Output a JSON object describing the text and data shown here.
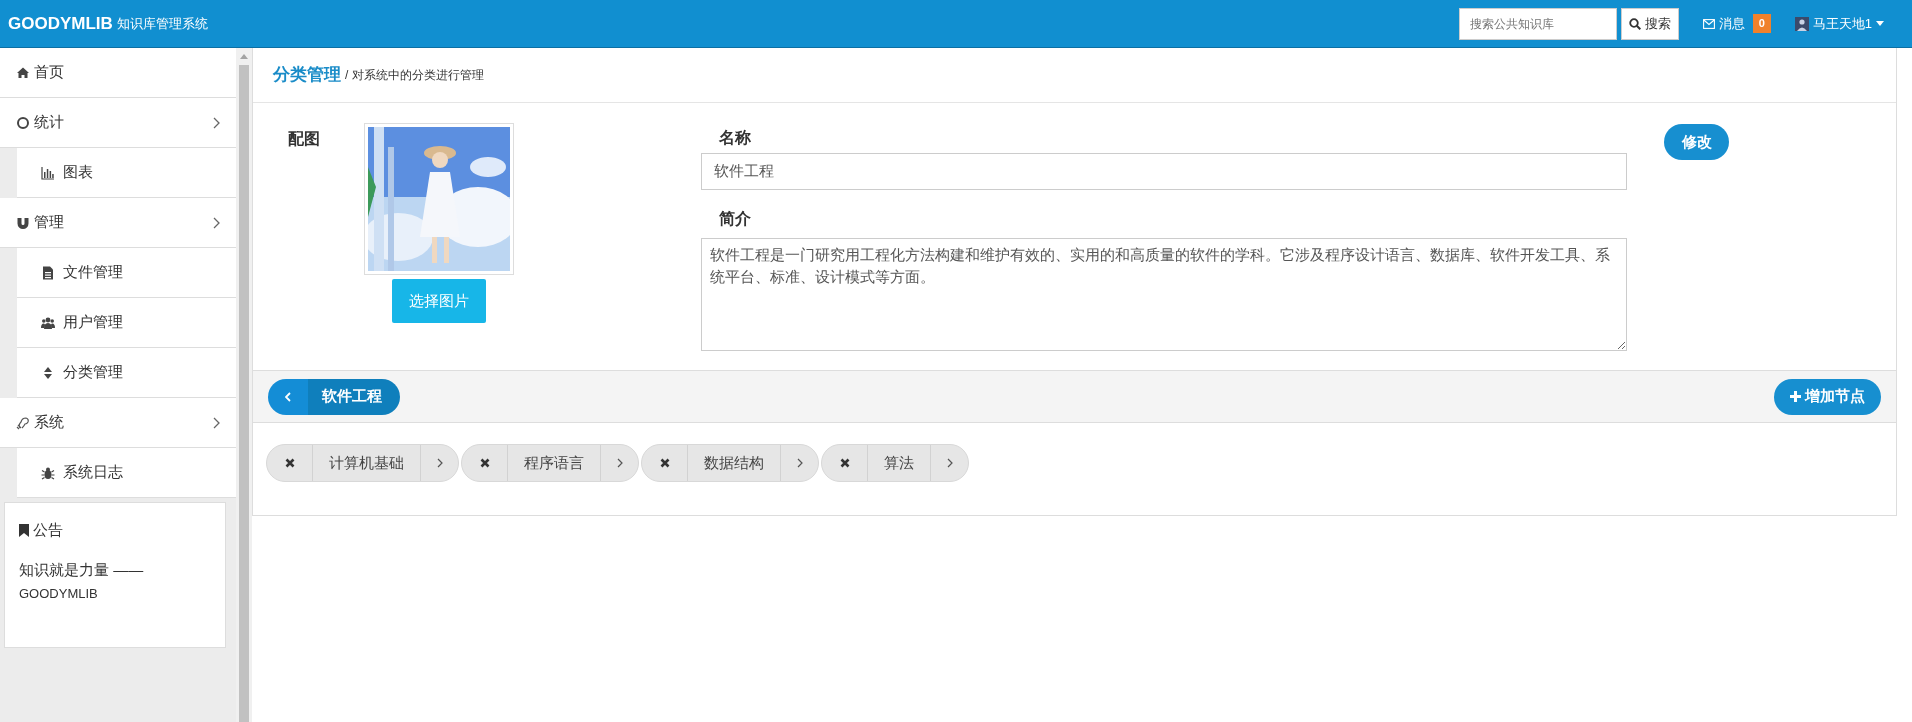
{
  "header": {
    "brand": "GOODYMLIB",
    "subtitle": "知识库管理系统",
    "search": {
      "placeholder": "搜索公共知识库"
    },
    "search_button": "搜索",
    "messages": {
      "label": "消息",
      "count": "0"
    },
    "user": "马王天地1"
  },
  "sidebar": {
    "items": [
      {
        "label": "首页"
      },
      {
        "label": "统计",
        "children": [
          {
            "label": "图表"
          }
        ]
      },
      {
        "label": "管理",
        "children": [
          {
            "label": "文件管理"
          },
          {
            "label": "用户管理"
          },
          {
            "label": "分类管理"
          }
        ]
      },
      {
        "label": "系统",
        "children": [
          {
            "label": "系统日志"
          }
        ]
      }
    ],
    "notice": {
      "title": "公告",
      "lines": [
        "知识就是力量 ——",
        "GOODYMLIB"
      ]
    }
  },
  "page": {
    "title": "分类管理",
    "subtitle": "/ 对系统中的分类进行管理"
  },
  "form": {
    "image_label": "配图",
    "choose_button": "选择图片",
    "name_label": "名称",
    "name_value": "软件工程",
    "intro_label": "简介",
    "intro_value": "软件工程是一门研究用工程化方法构建和维护有效的、实用的和高质量的软件的学科。它涉及程序设计语言、数据库、软件开发工具、系统平台、标准、设计模式等方面。",
    "save_button": "修改"
  },
  "node_bar": {
    "current": "软件工程",
    "add_button": "增加节点"
  },
  "nodes": [
    {
      "label": "计算机基础"
    },
    {
      "label": "程序语言"
    },
    {
      "label": "数据结构"
    },
    {
      "label": "算法"
    }
  ]
}
